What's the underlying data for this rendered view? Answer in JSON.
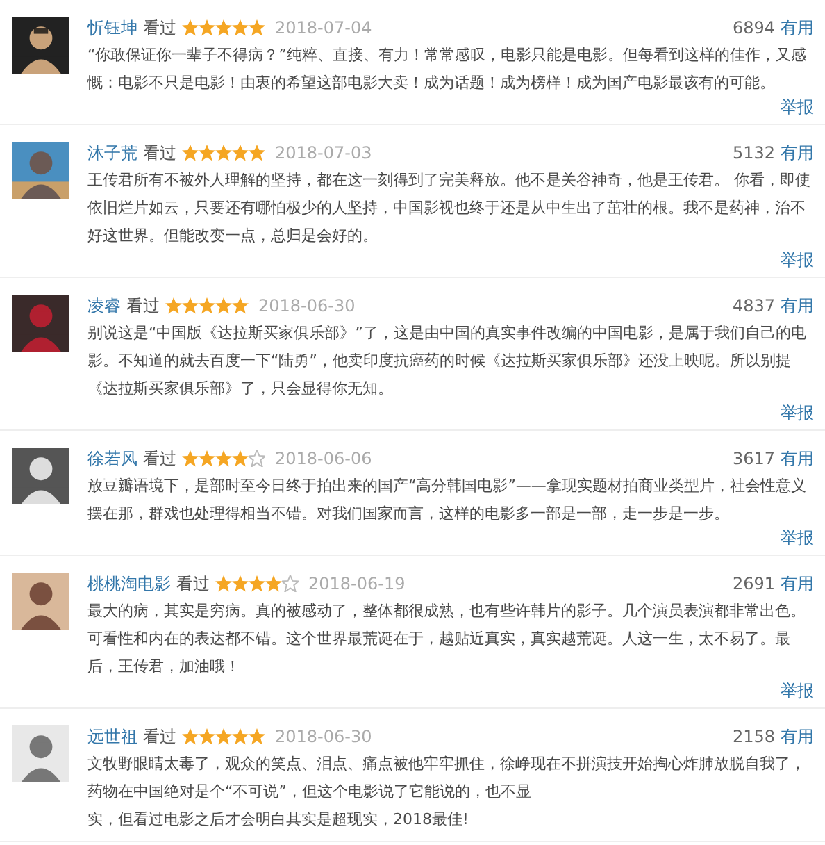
{
  "reviews": [
    {
      "user": "忻钰坤",
      "action": "看过",
      "stars": 5,
      "date": "2018-07-04",
      "votes": "6894",
      "useful": "有用",
      "text": "“你敢保证你一辈子不得病？”纯粹、直接、有力！常常感叹，电影只能是电影。但每看到这样的佳作，又感慨：电影不只是电影！由衷的希望这部电影大卖！成为话题！成为榜样！成为国产电影最该有的可能。",
      "report": "举报"
    },
    {
      "user": "沐子荒",
      "action": "看过",
      "stars": 5,
      "date": "2018-07-03",
      "votes": "5132",
      "useful": "有用",
      "text": "王传君所有不被外人理解的坚持，都在这一刻得到了完美释放。他不是关谷神奇，他是王传君。 你看，即使依旧烂片如云，只要还有哪怕极少的人坚持，中国影视也终于还是从中生出了茁壮的根。我不是药神，治不好这世界。但能改变一点，总归是会好的。",
      "report": "举报"
    },
    {
      "user": "凌睿",
      "action": "看过",
      "stars": 5,
      "date": "2018-06-30",
      "votes": "4837",
      "useful": "有用",
      "text": "别说这是“中国版《达拉斯买家俱乐部》”了，这是由中国的真实事件改编的中国电影，是属于我们自己的电影。不知道的就去百度一下“陆勇”，他卖印度抗癌药的时候《达拉斯买家俱乐部》还没上映呢。所以别提《达拉斯买家俱乐部》了，只会显得你无知。",
      "report": "举报"
    },
    {
      "user": "徐若风",
      "action": "看过",
      "stars": 4,
      "date": "2018-06-06",
      "votes": "3617",
      "useful": "有用",
      "text": "放豆瓣语境下，是部时至今日终于拍出来的国产“高分韩国电影”——拿现实题材拍商业类型片，社会性意义摆在那，群戏也处理得相当不错。对我们国家而言，这样的电影多一部是一部，走一步是一步。",
      "report": "举报"
    },
    {
      "user": "桃桃淘电影",
      "action": "看过",
      "stars": 4,
      "date": "2018-06-19",
      "votes": "2691",
      "useful": "有用",
      "text": "最大的病，其实是穷病。真的被感动了，整体都很成熟，也有些许韩片的影子。几个演员表演都非常出色。可看性和内在的表达都不错。这个世界最荒诞在于，越贴近真实，真实越荒诞。人这一生，太不易了。最后，王传君，加油哦！",
      "report": "举报"
    },
    {
      "user": "远世祖",
      "action": "看过",
      "stars": 5,
      "date": "2018-06-30",
      "votes": "2158",
      "useful": "有用",
      "text": "文牧野眼睛太毒了，观众的笑点、泪点、痛点被他牢牢抓住，徐峥现在不拼演技开始掏心炸肺放脱自我了，药物在中国绝对是个“不可说”，但这个电影说了它能说的，也不显",
      "text_end": "实，但看过电影之后才会明白其实是超现实，2018最佳!"
    }
  ]
}
